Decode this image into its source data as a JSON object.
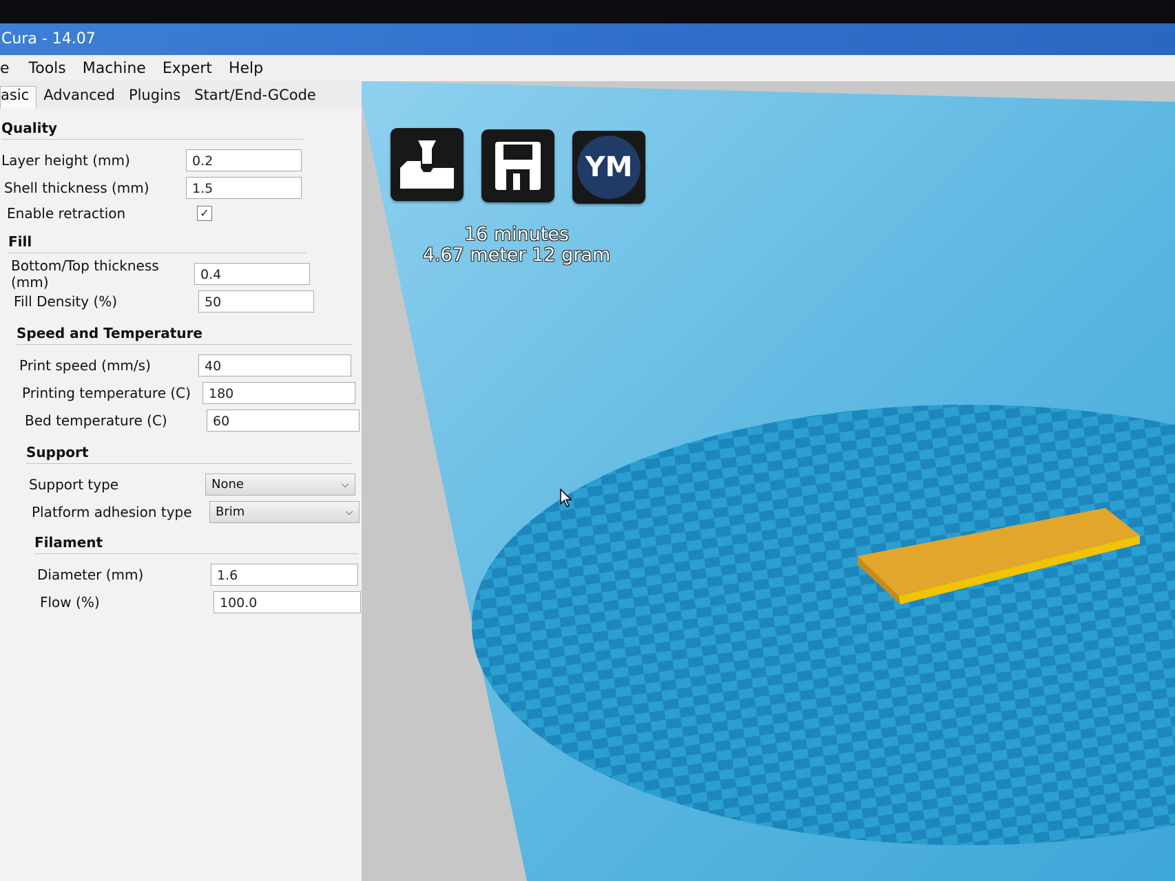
{
  "window": {
    "title": "Cura - 14.07"
  },
  "menu": [
    {
      "id": "file",
      "label": "e"
    },
    {
      "id": "tools",
      "label": "Tools"
    },
    {
      "id": "machine",
      "label": "Machine"
    },
    {
      "id": "expert",
      "label": "Expert"
    },
    {
      "id": "help",
      "label": "Help"
    }
  ],
  "tabs": [
    {
      "id": "basic",
      "label": "asic"
    },
    {
      "id": "advanced",
      "label": "Advanced"
    },
    {
      "id": "plugins",
      "label": "Plugins"
    },
    {
      "id": "gcode",
      "label": "Start/End-GCode"
    }
  ],
  "quality": {
    "title": "Quality",
    "layer_height_label": "Layer height (mm)",
    "layer_height_value": "0.2",
    "shell_thickness_label": "Shell thickness (mm)",
    "shell_thickness_value": "1.5",
    "retraction_label": "Enable retraction",
    "retraction_checked": true
  },
  "fill": {
    "title": "Fill",
    "bottom_top_label": "Bottom/Top thickness (mm)",
    "bottom_top_value": "0.4",
    "density_label": "Fill Density (%)",
    "density_value": "50"
  },
  "speed": {
    "title": "Speed and Temperature",
    "print_speed_label": "Print speed (mm/s)",
    "print_speed_value": "40",
    "print_temp_label": "Printing temperature (C)",
    "print_temp_value": "180",
    "bed_temp_label": "Bed temperature (C)",
    "bed_temp_value": "60"
  },
  "support": {
    "title": "Support",
    "type_label": "Support type",
    "type_value": "None",
    "adhesion_label": "Platform adhesion type",
    "adhesion_value": "Brim"
  },
  "filament": {
    "title": "Filament",
    "diameter_label": "Diameter (mm)",
    "diameter_value": "1.6",
    "flow_label": "Flow (%)",
    "flow_value": "100.0"
  },
  "viewport": {
    "load_icon": "load-model-icon",
    "save_icon": "save-disk-icon",
    "ym_label": "YM",
    "print_time": "16 minutes",
    "material": "4.67 meter 12 gram",
    "colors": {
      "sky": "#5fb9e2",
      "platform": "#2a9fd0",
      "model": "#e2a62c"
    }
  }
}
